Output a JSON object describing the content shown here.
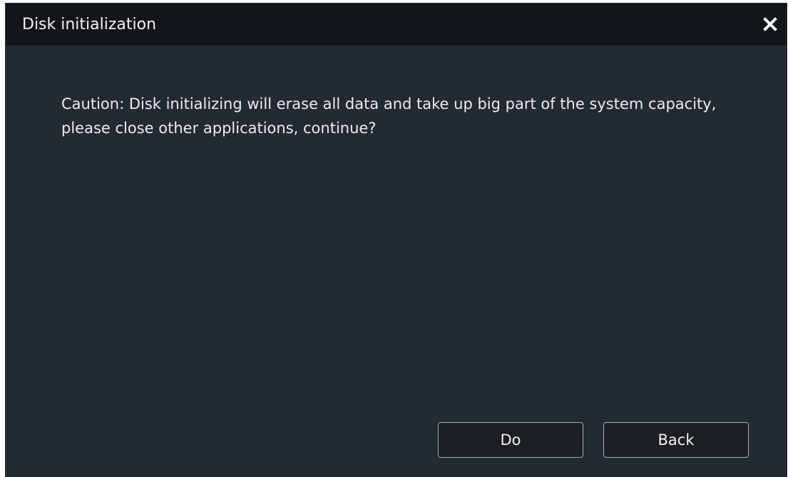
{
  "dialog": {
    "title": "Disk initialization",
    "close_icon": "close-icon",
    "message": "Caution: Disk initializing will erase all data and take up big part of the system capacity, please close other applications, continue?",
    "buttons": {
      "do_label": "Do",
      "back_label": "Back"
    }
  },
  "colors": {
    "titlebar": "#12161a",
    "body": "#242a31",
    "button_bg": "#1b1f24",
    "button_border": "#a9adb2",
    "text": "#f2f2f2"
  }
}
